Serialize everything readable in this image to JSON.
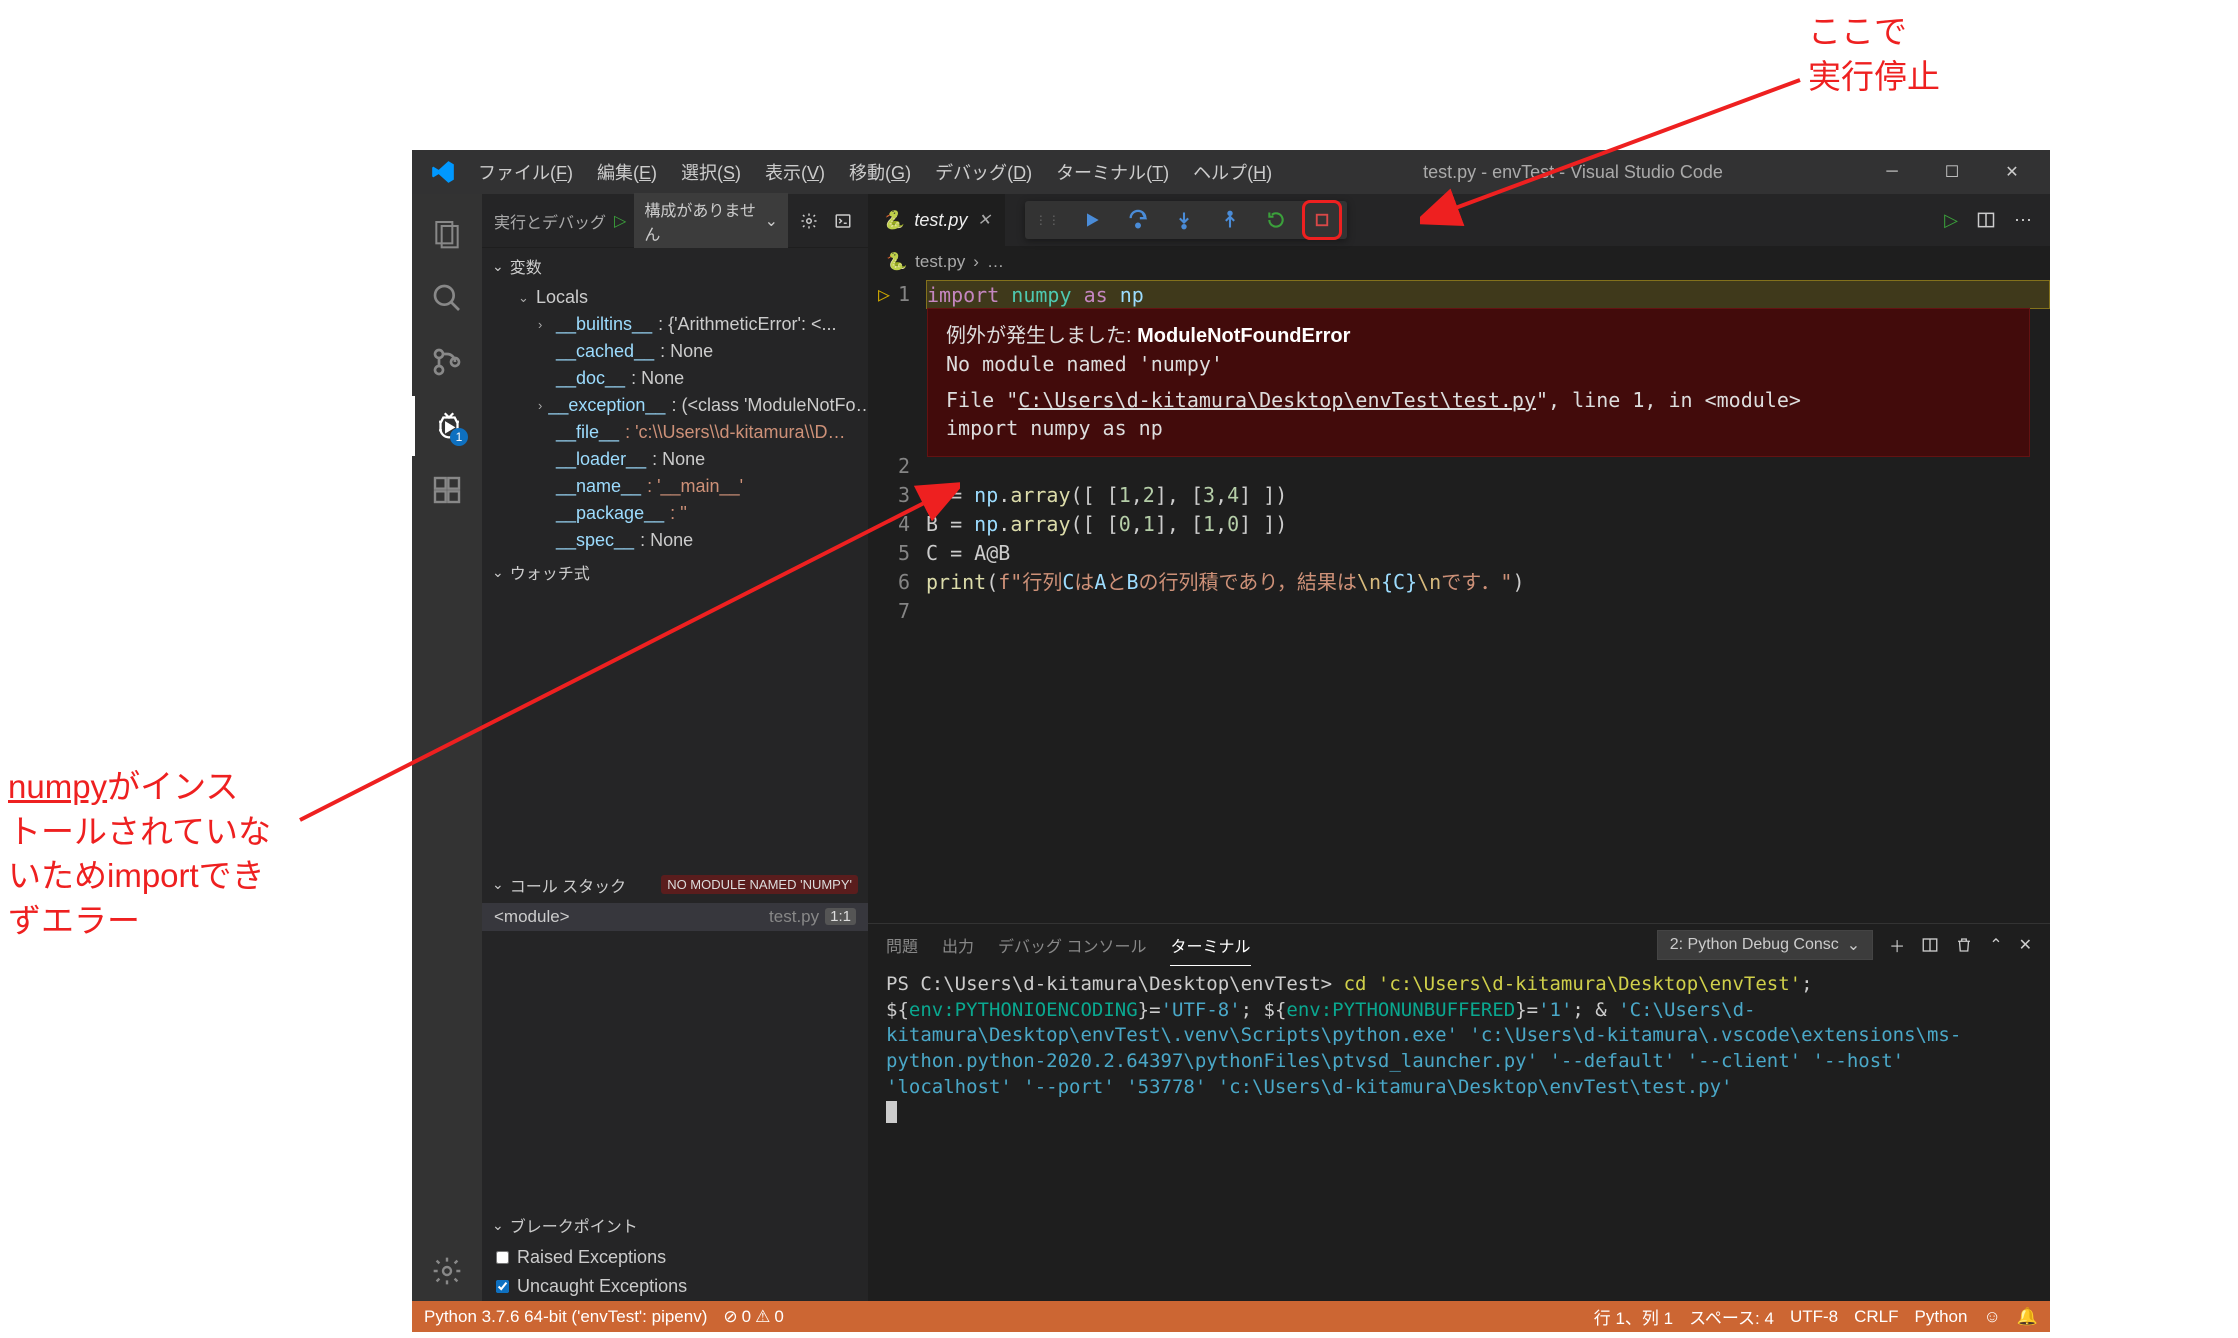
{
  "annotations": {
    "top_line1": "ここで",
    "top_line2": "実行停止",
    "left_l1": "numpy",
    "left_l1b": "がインス",
    "left_l2": "トールされていな",
    "left_l3": "いためimportでき",
    "left_l4": "ずエラー"
  },
  "titlebar": {
    "menus": {
      "file": "ファイル",
      "file_hk": "F",
      "edit": "編集",
      "edit_hk": "E",
      "select": "選択",
      "select_hk": "S",
      "view": "表示",
      "view_hk": "V",
      "goto": "移動",
      "goto_hk": "G",
      "debug": "デバッグ",
      "debug_hk": "D",
      "terminal": "ターミナル",
      "terminal_hk": "T",
      "help": "ヘルプ",
      "help_hk": "H"
    },
    "title": "test.py - envTest - Visual Studio Code"
  },
  "sidebar": {
    "run_debug_label": "実行とデバッグ",
    "config_label": "構成がありません",
    "sections": {
      "variables": "変数",
      "locals": "Locals",
      "watch": "ウォッチ式",
      "callstack": "コール スタック",
      "breakpoints": "ブレークポイント"
    },
    "vars": {
      "builtins_name": "__builtins__",
      "builtins_val": ": {'ArithmeticError': <...",
      "cached_name": "__cached__",
      "cached_val": ": None",
      "doc_name": "__doc__",
      "doc_val": ": None",
      "exception_name": "__exception__",
      "exception_val": ": (<class 'ModuleNotFo…",
      "file_name": "__file__",
      "file_val": ": 'c:\\\\Users\\\\d-kitamura\\\\D…",
      "loader_name": "__loader__",
      "loader_val": ": None",
      "name_name": "__name__",
      "name_val": ": '__main__'",
      "package_name": "__package__",
      "package_val": ": ''",
      "spec_name": "__spec__",
      "spec_val": ": None"
    },
    "callstack_badge": "NO MODULE NAMED 'NUMPY'",
    "callstack_module": "<module>",
    "callstack_file": "test.py",
    "callstack_line": "1:1",
    "bp_raised": "Raised Exceptions",
    "bp_uncaught": "Uncaught Exceptions"
  },
  "tabs": {
    "filename": "test.py"
  },
  "breadcrumb": {
    "file": "test.py",
    "more": "…"
  },
  "code": {
    "line1": "import numpy as np",
    "line3": "A = np.array([ [1,2], [3,4] ])",
    "line4": "B = np.array([ [0,1], [1,0] ])",
    "line5": "C = A@B",
    "line6_pre": "print(f\"",
    "line6_txt1": "行列",
    "line6_C": "C",
    "line6_txt2": "は",
    "line6_A": "A",
    "line6_txt3": "と",
    "line6_B": "B",
    "line6_txt4": "の行列積であり，結果は",
    "line6_esc1": "\\n",
    "line6_var": "{C}",
    "line6_esc2": "\\n",
    "line6_txt5": "です．",
    "line6_end": "\")"
  },
  "exception": {
    "prefix": "例外が発生しました:",
    "type": "ModuleNotFoundError",
    "msg": "No module named 'numpy'",
    "trace1a": "  File \"",
    "trace1_path": "C:\\Users\\d-kitamura\\Desktop\\envTest\\test.py",
    "trace1b": "\", line 1, in <module>",
    "trace2": "    import numpy as np"
  },
  "panel": {
    "tabs": {
      "problems": "問題",
      "output": "出力",
      "debug_console": "デバッグ コンソール",
      "terminal": "ターミナル"
    },
    "dropdown": "2: Python Debug Consc",
    "term": {
      "ps": "PS C:\\Users\\d-kitamura\\Desktop\\envTest> ",
      "cd": "cd 'c:\\Users\\d-kitamura\\Desktop\\envTest'",
      "sep1": "; ",
      "env1a": "${",
      "env1b": "env:PYTHONIOENCODING",
      "env1c": "}=",
      "env1v": "'UTF-8'",
      "sep2": "; ",
      "env2a": "${",
      "env2b": "env:PYTHONUNBUFFERED",
      "env2c": "}=",
      "env2v": "'1'",
      "sep3": "; & ",
      "exe": "'C:\\Users\\d-kitamura\\Desktop\\envTest\\.venv\\Scripts\\python.exe' 'c:\\Users\\d-kitamura\\.vscode\\extensions\\ms-python.python-2020.2.64397\\pythonFiles\\ptvsd_launcher.py' '--default' '--client' '--host' 'localhost' '--port' '53778' 'c:\\Users\\d-kitamura\\Desktop\\envTest\\test.py'"
    }
  },
  "statusbar": {
    "python": "Python 3.7.6 64-bit ('envTest': pipenv)",
    "errors": "0",
    "warnings": "0",
    "pos": "行 1、列 1",
    "spaces": "スペース: 4",
    "encoding": "UTF-8",
    "eol": "CRLF",
    "lang": "Python"
  },
  "activity": {
    "debug_badge": "1"
  }
}
